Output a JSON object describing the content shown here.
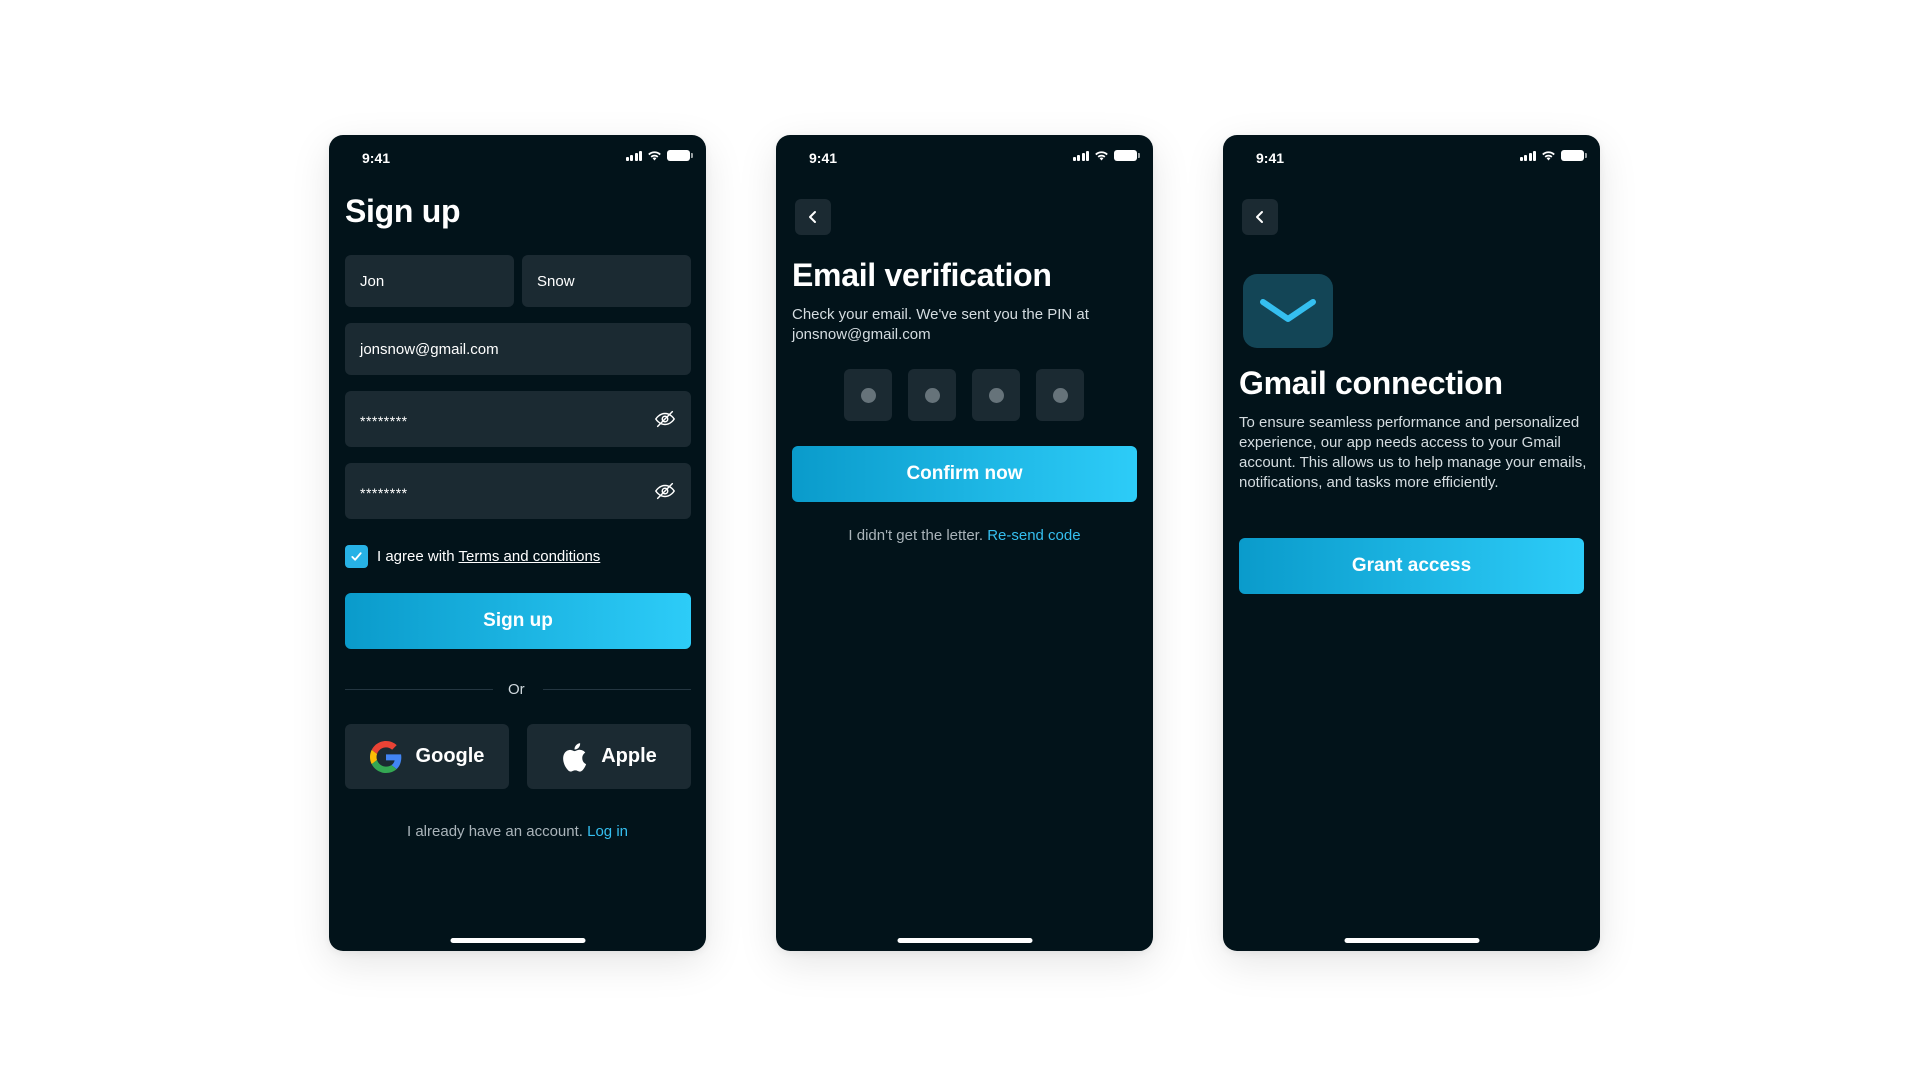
{
  "status_bar": {
    "time": "9:41"
  },
  "signup": {
    "title": "Sign up",
    "first_name": "Jon",
    "last_name": "Snow",
    "email": "jonsnow@gmail.com",
    "password_mask": "********",
    "confirm_password_mask": "********",
    "agree_text": "I agree with",
    "terms_link": "Terms and conditions",
    "submit_label": "Sign up",
    "divider_text": "Or",
    "google_label": "Google",
    "apple_label": "Apple",
    "have_account_text": "I already have an account.",
    "login_link": "Log in"
  },
  "verification": {
    "title": "Email verification",
    "description": "Check your email. We've sent you the PIN at jonsnow@gmail.com",
    "confirm_label": "Confirm now",
    "no_letter_text": "I didn't get the letter.",
    "resend_link": "Re-send code"
  },
  "gmail": {
    "title": "Gmail connection",
    "description": "To ensure seamless performance and personalized experience, our app needs access to your Gmail account. This allows us to help manage your emails, notifications, and tasks more efficiently.",
    "grant_label": "Grant access"
  },
  "colors": {
    "background": "#02131a",
    "field": "#1b2a32",
    "accent": "#27b2e6",
    "link": "#35bff0"
  },
  "icons": [
    "signal-icon",
    "wifi-icon",
    "battery-icon",
    "eye-off-icon",
    "checkmark-icon",
    "google-icon",
    "apple-icon",
    "chevron-left-icon",
    "mail-icon"
  ]
}
